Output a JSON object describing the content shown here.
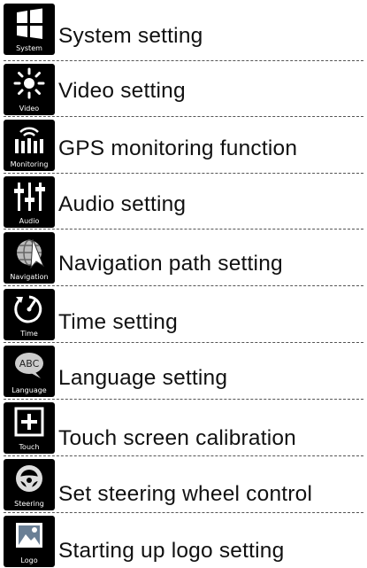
{
  "items": [
    {
      "icon": "system-icon",
      "caption": "System",
      "label": "System setting"
    },
    {
      "icon": "video-icon",
      "caption": "Video",
      "label": "Video setting"
    },
    {
      "icon": "monitoring-icon",
      "caption": "Monitoring",
      "label": "GPS monitoring function"
    },
    {
      "icon": "audio-icon",
      "caption": "Audio",
      "label": "Audio setting"
    },
    {
      "icon": "navigation-icon",
      "caption": "Navigation",
      "label": "Navigation path setting"
    },
    {
      "icon": "time-icon",
      "caption": "Time",
      "label": "Time setting"
    },
    {
      "icon": "language-icon",
      "caption": "Language",
      "label": "Language setting"
    },
    {
      "icon": "touch-icon",
      "caption": "Touch",
      "label": "Touch screen calibration"
    },
    {
      "icon": "steering-icon",
      "caption": "Steering",
      "label": "Set steering wheel control"
    },
    {
      "icon": "logo-icon",
      "caption": "Logo",
      "label": "Starting up logo setting"
    }
  ]
}
